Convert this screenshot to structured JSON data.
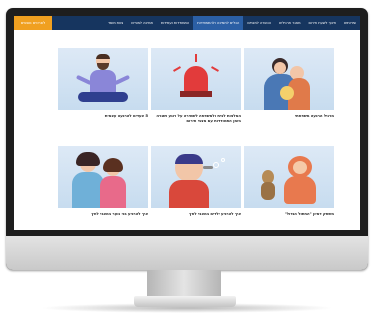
{
  "nav": {
    "items": [
      {
        "label": "שירותים"
      },
      {
        "label": "חינוך לשעת חירום"
      },
      {
        "label": "מאגר תרגילים"
      },
      {
        "label": "הכשרה למנחים"
      },
      {
        "label": "הכלים לתמיכה ולהתמודדות",
        "active": true
      },
      {
        "label": "התמודדות ועמידות"
      },
      {
        "label": "תמיכה למורים"
      },
      {
        "label": "צוות מוסד"
      }
    ],
    "cta": "לפרטים נוספים"
  },
  "cards": [
    {
      "caption": "מרגיל הרגעה משפחתי",
      "illustration": "family-hug"
    },
    {
      "caption": "המלצות לבית ולמשפחה לשמירה על רוגע ושגרה בזמן התמודדות עם מצבי חירום",
      "illustration": "siren"
    },
    {
      "caption": "5 צעדים להרגעה עצמית",
      "illustration": "meditating-man"
    },
    {
      "caption": "משחק דמיון \"החתול הגדול\"",
      "illustration": "monkey-cat"
    },
    {
      "caption": "איך להרגיע ילדים במצבי לחץ",
      "illustration": "child-breathing"
    },
    {
      "caption": "איך להרגיע בני נוער במצבי לחץ",
      "illustration": "mother-daughter"
    }
  ],
  "colors": {
    "nav_bg": "#16355f",
    "nav_active": "#2b5fa5",
    "cta": "#f0a020",
    "card_bg": "#d4e4f3"
  }
}
